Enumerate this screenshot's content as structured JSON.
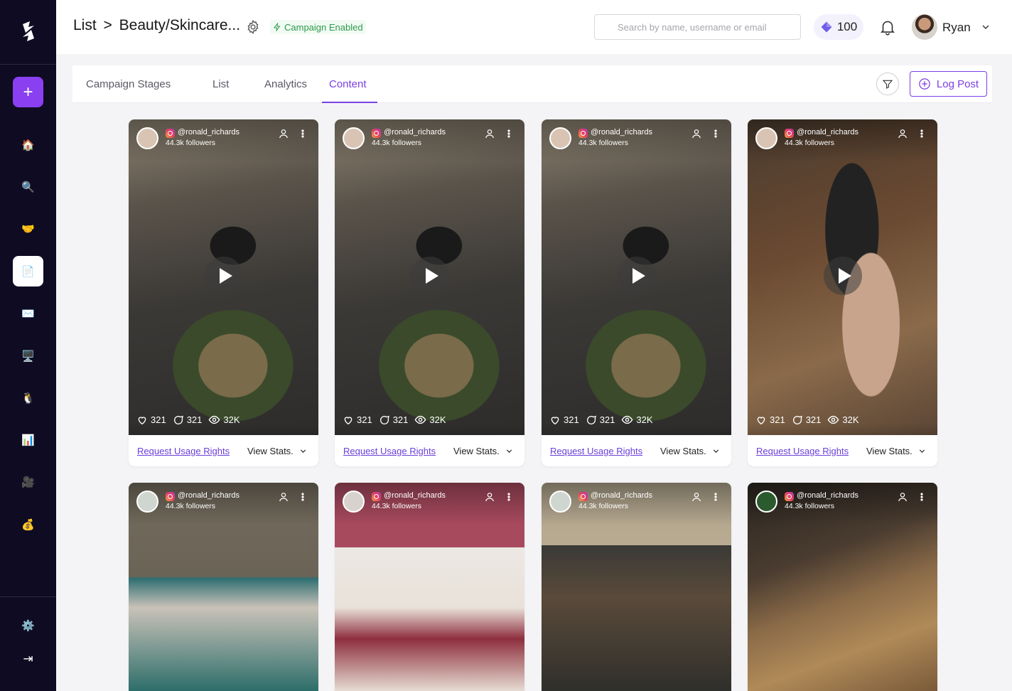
{
  "header": {
    "breadcrumb_root": "List",
    "breadcrumb_sep": ">",
    "breadcrumb_current": "Beauty/Skincare...",
    "campaign_badge": "Campaign Enabled",
    "search_placeholder": "Search by name, username or email",
    "credits": "100",
    "user_name": "Ryan"
  },
  "sidebar": {
    "items": [
      {
        "icon": "home-icon",
        "glyph": "🏠"
      },
      {
        "icon": "search-icon",
        "glyph": "🔍"
      },
      {
        "icon": "handshake-icon",
        "glyph": "🤝"
      },
      {
        "icon": "document-icon",
        "glyph": "📄",
        "active": true
      },
      {
        "icon": "mail-icon",
        "glyph": "✉️"
      },
      {
        "icon": "monitor-icon",
        "glyph": "🖥️"
      },
      {
        "icon": "mascot-icon",
        "glyph": "🐧"
      },
      {
        "icon": "chart-icon",
        "glyph": "📊"
      },
      {
        "icon": "camera-icon",
        "glyph": "🎥"
      },
      {
        "icon": "money-bag-icon",
        "glyph": "💰"
      }
    ],
    "bottom": [
      {
        "icon": "settings-icon",
        "glyph": "⚙️"
      },
      {
        "icon": "collapse-icon",
        "glyph": "⇥"
      }
    ]
  },
  "tabs": {
    "items": [
      "Campaign Stages",
      "List",
      "Analytics",
      "Content"
    ],
    "active": "Content",
    "log_post": "Log Post"
  },
  "cards": [
    {
      "handle": "@ronald_richards",
      "followers": "44.3k followers",
      "likes": "321",
      "comments": "321",
      "views": "32K",
      "request": "Request Usage Rights",
      "view_stats": "View Stats."
    },
    {
      "handle": "@ronald_richards",
      "followers": "44.3k followers",
      "likes": "321",
      "comments": "321",
      "views": "32K",
      "request": "Request Usage Rights",
      "view_stats": "View Stats."
    },
    {
      "handle": "@ronald_richards",
      "followers": "44.3k followers",
      "likes": "321",
      "comments": "321",
      "views": "32K",
      "request": "Request Usage Rights",
      "view_stats": "View Stats."
    },
    {
      "handle": "@ronald_richards",
      "followers": "44.3k followers",
      "likes": "321",
      "comments": "321",
      "views": "32K",
      "request": "Request Usage Rights",
      "view_stats": "View Stats."
    },
    {
      "handle": "@ronald_richards",
      "followers": "44.3k followers"
    },
    {
      "handle": "@ronald_richards",
      "followers": "44.3k followers"
    },
    {
      "handle": "@ronald_richards",
      "followers": "44.3k followers"
    },
    {
      "handle": "@ronald_richards",
      "followers": "44.3k followers"
    }
  ],
  "colors": {
    "accent": "#7b3fe4",
    "sidebar": "#0e0b23",
    "add_button": "#8a3ff0",
    "badge_green": "#2f9a4c"
  }
}
